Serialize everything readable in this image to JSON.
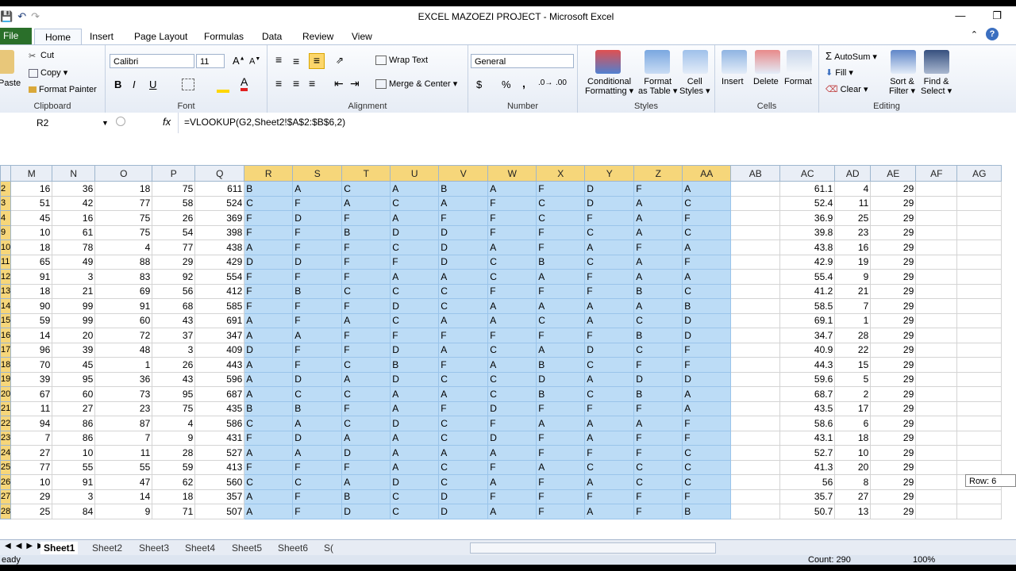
{
  "window": {
    "title": "EXCEL MAZOEZI PROJECT  -  Microsoft Excel"
  },
  "ribbon_tabs": [
    "File",
    "Home",
    "Insert",
    "Page Layout",
    "Formulas",
    "Data",
    "Review",
    "View"
  ],
  "clipboard": {
    "paste": "Paste",
    "cut": "Cut",
    "copy": "Copy",
    "format_painter": "Format Painter",
    "label": "Clipboard"
  },
  "font": {
    "name": "Calibri",
    "size": "11",
    "bold": "B",
    "italic": "I",
    "underline": "U",
    "label": "Font"
  },
  "alignment": {
    "wrap_text": "Wrap Text",
    "merge_center": "Merge & Center",
    "label": "Alignment"
  },
  "number": {
    "format": "General",
    "currency": "$",
    "percent": "%",
    "comma": ",",
    "label": "Number"
  },
  "styles": {
    "conditional_1": "Conditional",
    "conditional_2": "Formatting",
    "format_table_1": "Format",
    "format_table_2": "as Table",
    "cell_styles_1": "Cell",
    "cell_styles_2": "Styles",
    "label": "Styles"
  },
  "cells_group": {
    "insert": "Insert",
    "delete": "Delete",
    "format": "Format",
    "label": "Cells"
  },
  "editing": {
    "autosum": "AutoSum",
    "fill": "Fill",
    "clear": "Clear",
    "sort_1": "Sort &",
    "sort_2": "Filter",
    "find_1": "Find &",
    "find_2": "Select",
    "label": "Editing"
  },
  "formula_bar": {
    "name_box": "R2",
    "fx": "fx",
    "formula": "=VLOOKUP(G2,Sheet2!$A$2:$B$6,2)"
  },
  "columns": [
    "M",
    "N",
    "O",
    "P",
    "Q",
    "R",
    "S",
    "T",
    "U",
    "V",
    "W",
    "X",
    "Y",
    "Z",
    "AA",
    "AB",
    "AC",
    "AD",
    "AE",
    "AF",
    "AG"
  ],
  "rows": [
    {
      "rn": "2",
      "n": [
        "16",
        "36",
        "18",
        "75",
        "611"
      ],
      "g": [
        "B",
        "A",
        "C",
        "A",
        "B",
        "A",
        "F",
        "D",
        "F",
        "A"
      ],
      "ac": "61.1",
      "ad": "4",
      "ae": "29"
    },
    {
      "rn": "3",
      "n": [
        "51",
        "42",
        "77",
        "58",
        "524"
      ],
      "g": [
        "C",
        "F",
        "A",
        "C",
        "A",
        "F",
        "C",
        "D",
        "A",
        "C"
      ],
      "ac": "52.4",
      "ad": "11",
      "ae": "29"
    },
    {
      "rn": "4",
      "n": [
        "45",
        "16",
        "75",
        "26",
        "369"
      ],
      "g": [
        "F",
        "D",
        "F",
        "A",
        "F",
        "F",
        "C",
        "F",
        "A",
        "F"
      ],
      "ac": "36.9",
      "ad": "25",
      "ae": "29"
    },
    {
      "rn": "9",
      "n": [
        "10",
        "61",
        "75",
        "54",
        "398"
      ],
      "g": [
        "F",
        "F",
        "B",
        "D",
        "D",
        "F",
        "F",
        "C",
        "A",
        "C"
      ],
      "ac": "39.8",
      "ad": "23",
      "ae": "29"
    },
    {
      "rn": "10",
      "n": [
        "18",
        "78",
        "4",
        "77",
        "438"
      ],
      "g": [
        "A",
        "F",
        "F",
        "C",
        "D",
        "A",
        "F",
        "A",
        "F",
        "A"
      ],
      "ac": "43.8",
      "ad": "16",
      "ae": "29"
    },
    {
      "rn": "11",
      "n": [
        "65",
        "49",
        "88",
        "29",
        "429"
      ],
      "g": [
        "D",
        "D",
        "F",
        "F",
        "D",
        "C",
        "B",
        "C",
        "A",
        "F"
      ],
      "ac": "42.9",
      "ad": "19",
      "ae": "29"
    },
    {
      "rn": "12",
      "n": [
        "91",
        "3",
        "83",
        "92",
        "554"
      ],
      "g": [
        "F",
        "F",
        "F",
        "A",
        "A",
        "C",
        "A",
        "F",
        "A",
        "A"
      ],
      "ac": "55.4",
      "ad": "9",
      "ae": "29"
    },
    {
      "rn": "13",
      "n": [
        "18",
        "21",
        "69",
        "56",
        "412"
      ],
      "g": [
        "F",
        "B",
        "C",
        "C",
        "C",
        "F",
        "F",
        "F",
        "B",
        "C"
      ],
      "ac": "41.2",
      "ad": "21",
      "ae": "29"
    },
    {
      "rn": "14",
      "n": [
        "90",
        "99",
        "91",
        "68",
        "585"
      ],
      "g": [
        "F",
        "F",
        "F",
        "D",
        "C",
        "A",
        "A",
        "A",
        "A",
        "B"
      ],
      "ac": "58.5",
      "ad": "7",
      "ae": "29"
    },
    {
      "rn": "15",
      "n": [
        "59",
        "99",
        "60",
        "43",
        "691"
      ],
      "g": [
        "A",
        "F",
        "A",
        "C",
        "A",
        "A",
        "C",
        "A",
        "C",
        "D"
      ],
      "ac": "69.1",
      "ad": "1",
      "ae": "29"
    },
    {
      "rn": "16",
      "n": [
        "14",
        "20",
        "72",
        "37",
        "347"
      ],
      "g": [
        "A",
        "A",
        "F",
        "F",
        "F",
        "F",
        "F",
        "F",
        "B",
        "D"
      ],
      "ac": "34.7",
      "ad": "28",
      "ae": "29"
    },
    {
      "rn": "17",
      "n": [
        "96",
        "39",
        "48",
        "3",
        "409"
      ],
      "g": [
        "D",
        "F",
        "F",
        "D",
        "A",
        "C",
        "A",
        "D",
        "C",
        "F"
      ],
      "ac": "40.9",
      "ad": "22",
      "ae": "29"
    },
    {
      "rn": "18",
      "n": [
        "70",
        "45",
        "1",
        "26",
        "443"
      ],
      "g": [
        "A",
        "F",
        "C",
        "B",
        "F",
        "A",
        "B",
        "C",
        "F",
        "F"
      ],
      "ac": "44.3",
      "ad": "15",
      "ae": "29"
    },
    {
      "rn": "19",
      "n": [
        "39",
        "95",
        "36",
        "43",
        "596"
      ],
      "g": [
        "A",
        "D",
        "A",
        "D",
        "C",
        "C",
        "D",
        "A",
        "D",
        "D"
      ],
      "ac": "59.6",
      "ad": "5",
      "ae": "29"
    },
    {
      "rn": "20",
      "n": [
        "67",
        "60",
        "73",
        "95",
        "687"
      ],
      "g": [
        "A",
        "C",
        "C",
        "A",
        "A",
        "C",
        "B",
        "C",
        "B",
        "A"
      ],
      "ac": "68.7",
      "ad": "2",
      "ae": "29"
    },
    {
      "rn": "21",
      "n": [
        "11",
        "27",
        "23",
        "75",
        "435"
      ],
      "g": [
        "B",
        "B",
        "F",
        "A",
        "F",
        "D",
        "F",
        "F",
        "F",
        "A"
      ],
      "ac": "43.5",
      "ad": "17",
      "ae": "29"
    },
    {
      "rn": "22",
      "n": [
        "94",
        "86",
        "87",
        "4",
        "586"
      ],
      "g": [
        "C",
        "A",
        "C",
        "D",
        "C",
        "F",
        "A",
        "A",
        "A",
        "F"
      ],
      "ac": "58.6",
      "ad": "6",
      "ae": "29"
    },
    {
      "rn": "23",
      "n": [
        "7",
        "86",
        "7",
        "9",
        "431"
      ],
      "g": [
        "F",
        "D",
        "A",
        "A",
        "C",
        "D",
        "F",
        "A",
        "F",
        "F"
      ],
      "ac": "43.1",
      "ad": "18",
      "ae": "29"
    },
    {
      "rn": "24",
      "n": [
        "27",
        "10",
        "11",
        "28",
        "527"
      ],
      "g": [
        "A",
        "A",
        "D",
        "A",
        "A",
        "A",
        "F",
        "F",
        "F",
        "C"
      ],
      "ac": "52.7",
      "ad": "10",
      "ae": "29"
    },
    {
      "rn": "25",
      "n": [
        "77",
        "55",
        "55",
        "59",
        "413"
      ],
      "g": [
        "F",
        "F",
        "F",
        "A",
        "C",
        "F",
        "A",
        "C",
        "C",
        "C"
      ],
      "ac": "41.3",
      "ad": "20",
      "ae": "29"
    },
    {
      "rn": "26",
      "n": [
        "10",
        "91",
        "47",
        "62",
        "560"
      ],
      "g": [
        "C",
        "C",
        "A",
        "D",
        "C",
        "A",
        "F",
        "A",
        "C",
        "C"
      ],
      "ac": "56",
      "ad": "8",
      "ae": "29"
    },
    {
      "rn": "27",
      "n": [
        "29",
        "3",
        "14",
        "18",
        "357"
      ],
      "g": [
        "A",
        "F",
        "B",
        "C",
        "D",
        "F",
        "F",
        "F",
        "F",
        "F"
      ],
      "ac": "35.7",
      "ad": "27",
      "ae": "29"
    },
    {
      "rn": "28",
      "n": [
        "25",
        "84",
        "9",
        "71",
        "507"
      ],
      "g": [
        "A",
        "F",
        "D",
        "C",
        "D",
        "A",
        "F",
        "A",
        "F",
        "B"
      ],
      "ac": "50.7",
      "ad": "13",
      "ae": "29"
    }
  ],
  "row_tooltip": "Row: 6",
  "sheets": [
    "Sheet1",
    "Sheet2",
    "Sheet3",
    "Sheet4",
    "Sheet5",
    "Sheet6",
    "S("
  ],
  "status": {
    "ready": "eady",
    "count": "Count: 290",
    "zoom": "100%"
  },
  "colors": {
    "selection": "#bcdcf6",
    "header_selected": "#f6d67a",
    "file_tab": "#2a6f2a"
  },
  "icons": [
    "save-icon",
    "undo-icon",
    "redo-icon",
    "minimize-icon",
    "restore-icon",
    "help-icon",
    "paste-icon",
    "cut-icon",
    "copy-icon",
    "format-painter-icon",
    "fill-color-icon",
    "font-color-icon",
    "autosum-icon",
    "sort-filter-icon",
    "find-icon"
  ]
}
